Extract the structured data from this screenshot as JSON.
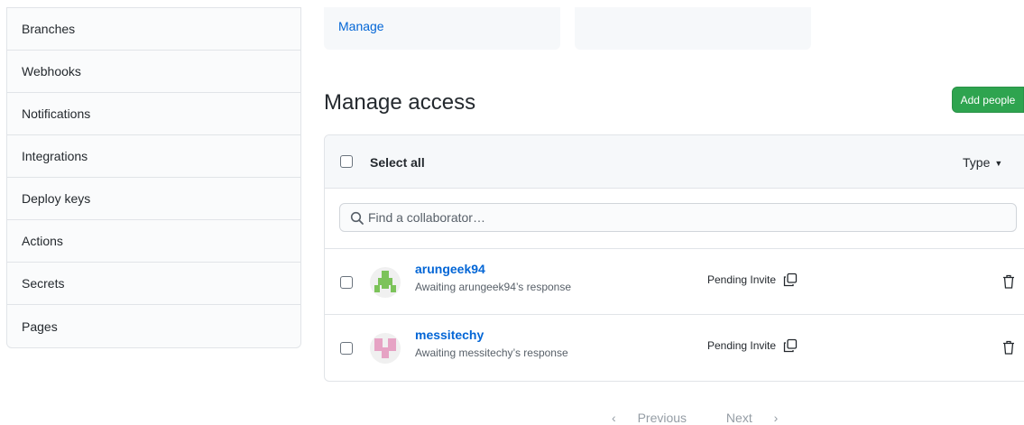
{
  "sidebar": {
    "items": [
      {
        "label": "Branches"
      },
      {
        "label": "Webhooks"
      },
      {
        "label": "Notifications"
      },
      {
        "label": "Integrations"
      },
      {
        "label": "Deploy keys"
      },
      {
        "label": "Actions"
      },
      {
        "label": "Secrets"
      },
      {
        "label": "Pages"
      }
    ]
  },
  "top_cards": {
    "manage_link": "Manage"
  },
  "access": {
    "title": "Manage access",
    "add_people_label": "Add people",
    "select_all_label": "Select all",
    "type_filter_label": "Type",
    "search_placeholder": "Find a collaborator…",
    "members": [
      {
        "username": "arungeek94",
        "status_text": "Awaiting arungeek94’s response",
        "invite_state": "Pending Invite",
        "avatar_color": "#7cc35a"
      },
      {
        "username": "messitechy",
        "status_text": "Awaiting messitechy’s response",
        "invite_state": "Pending Invite",
        "avatar_color": "#e6a3c4"
      }
    ]
  },
  "pagination": {
    "previous_label": "Previous",
    "next_label": "Next"
  },
  "colors": {
    "link": "#0366d6",
    "primary_button": "#2ea44f"
  }
}
